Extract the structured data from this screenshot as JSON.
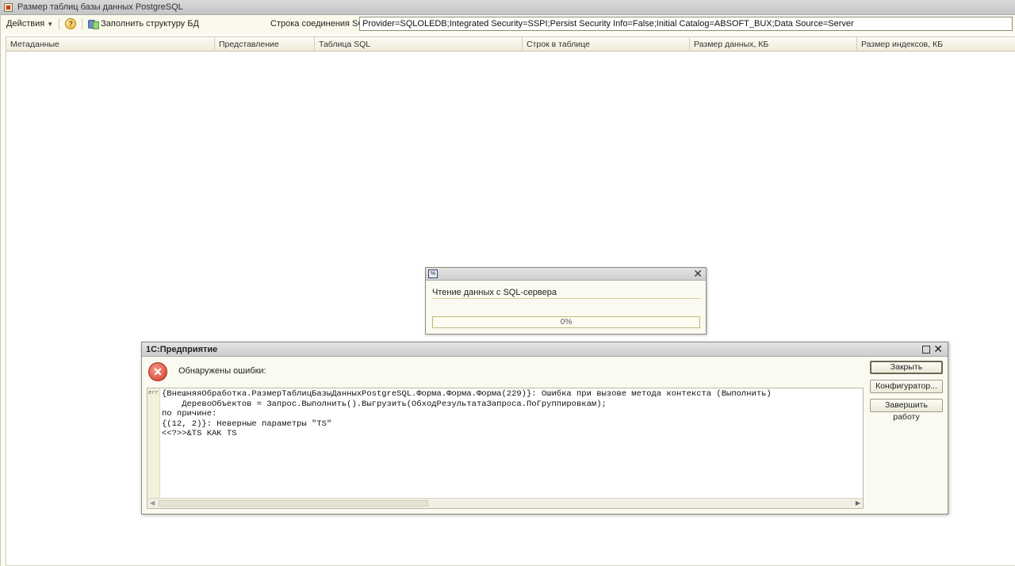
{
  "window": {
    "title": "Размер таблиц базы данных PostgreSQL"
  },
  "toolbar": {
    "actions_label": "Действия",
    "help_glyph": "?",
    "fill_structure_label": "Заполнить структуру БД",
    "connection_label": "Строка соединения SQL:",
    "connection_value": "Provider=SQLOLEDB;Integrated Security=SSPI;Persist Security Info=False;Initial Catalog=ABSOFT_BUX;Data Source=Server"
  },
  "table": {
    "columns": [
      "Метаданные",
      "Представление",
      "Таблица SQL",
      "Строк в таблице",
      "Размер данных, КБ",
      "Размер индексов, КБ"
    ]
  },
  "progress_dialog": {
    "icon_glyph": "%",
    "message": "Чтение данных с SQL-сервера",
    "progress_fraction": 0,
    "progress_text": "0%"
  },
  "error_dialog": {
    "title": "1С:Предприятие",
    "header": "Обнаружены ошибки:",
    "gutter_tag": "err",
    "lines": [
      "{ВнешняяОбработка.РазмерТаблицБазыДанныхPostgreSQL.Форма.Форма.Форма(229)}: Ошибка при вызове метода контекста (Выполнить)",
      "    ДеревоОбъектов = Запрос.Выполнить().Выгрузить(ОбходРезультатаЗапроса.ПоГруппировкам);",
      "по причине:",
      "{(12, 2)}: Неверные параметры \"TS\"",
      "<<?>>&TS КАК TS"
    ],
    "buttons": {
      "close": "Закрыть",
      "configurator": "Конфигуратор...",
      "finish": "Завершить работу"
    }
  },
  "colors": {
    "window_bg": "#fbfaf3",
    "error_icon": "#d23a26",
    "progress_fill": "#f0c33c"
  }
}
